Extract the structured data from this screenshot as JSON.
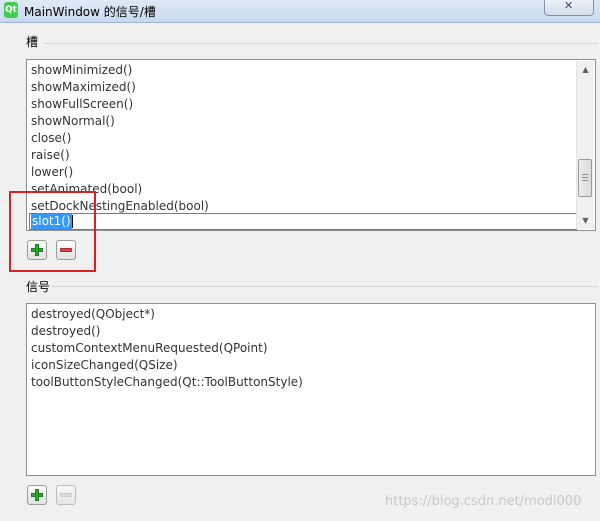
{
  "window": {
    "title": "MainWindow 的信号/槽",
    "close_glyph": "✕",
    "app_icon_text": "Qt"
  },
  "slots": {
    "group_title": "槽",
    "items": [
      "showMinimized()",
      "showMaximized()",
      "showFullScreen()",
      "showNormal()",
      "close()",
      "raise()",
      "lower()",
      "setAnimated(bool)",
      "setDockNestingEnabled(bool)"
    ],
    "editing_value": "slot1()"
  },
  "signals": {
    "group_title": "信号",
    "items": [
      "destroyed(QObject*)",
      "destroyed()",
      "customContextMenuRequested(QPoint)",
      "iconSizeChanged(QSize)",
      "toolButtonStyleChanged(Qt::ToolButtonStyle)"
    ]
  },
  "icons": {
    "add": "plus-icon",
    "remove": "minus-icon",
    "scroll_up": "▲",
    "scroll_down": "▼"
  },
  "colors": {
    "selection": "#3399ff",
    "add_green": "#2eaa2e",
    "remove_red": "#e04848",
    "annotation_red": "#e02020"
  },
  "watermark": "https://blog.csdn.net/modi000"
}
